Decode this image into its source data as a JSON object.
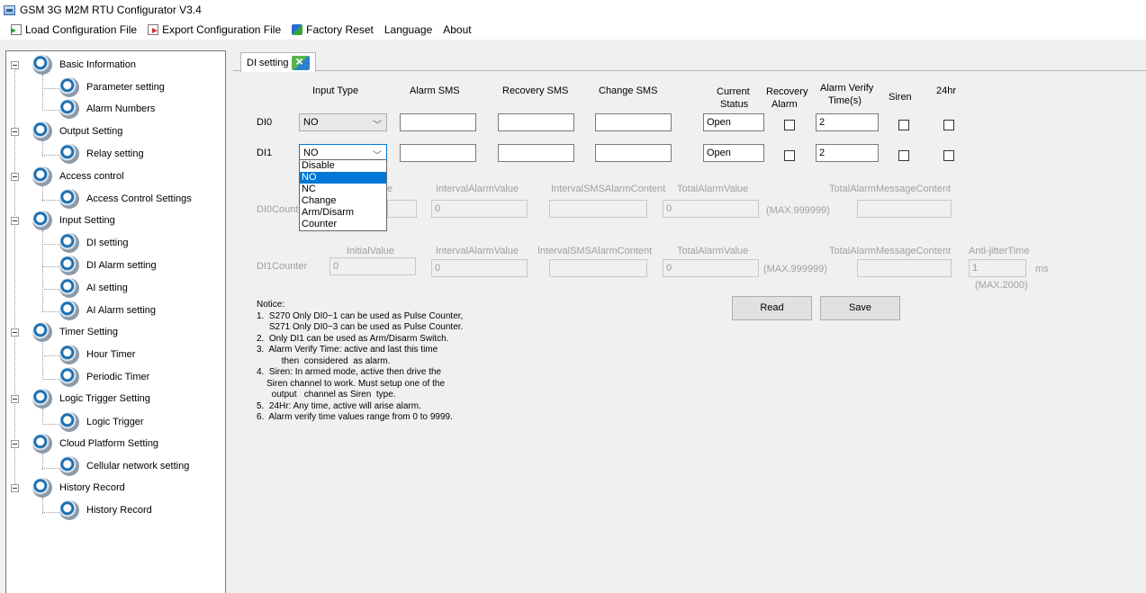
{
  "window": {
    "title": "GSM 3G M2M RTU Configurator V3.4"
  },
  "menu": {
    "load_config": "Load Configuration File",
    "export_config": "Export Configuration File",
    "factory_reset": "Factory Reset",
    "language": "Language",
    "about": "About"
  },
  "tree": {
    "basic_information": "Basic Information",
    "parameter_setting": "Parameter setting",
    "alarm_numbers": "Alarm Numbers",
    "output_setting": "Output Setting",
    "relay_setting": "Relay setting",
    "access_control": "Access control",
    "access_control_settings": "Access Control Settings",
    "input_setting": "Input Setting",
    "di_setting": "DI setting",
    "di_alarm_setting": "DI Alarm setting",
    "ai_setting": "AI setting",
    "ai_alarm_setting": "AI Alarm setting",
    "timer_setting": "Timer Setting",
    "hour_timer": "Hour Timer",
    "periodic_timer": "Periodic Timer",
    "logic_trigger_setting": "Logic Trigger Setting",
    "logic_trigger": "Logic Trigger",
    "cloud_platform_setting": "Cloud Platform Setting",
    "cellular_network_setting": "Cellular network setting",
    "history_record_group": "History Record",
    "history_record": "History Record"
  },
  "tab": {
    "label": "DI setting"
  },
  "headers": {
    "input_type": "Input Type",
    "alarm_sms": "Alarm SMS",
    "recovery_sms": "Recovery SMS",
    "change_sms": "Change SMS",
    "current_status_1": "Current",
    "current_status_2": "Status",
    "recovery_alarm_1": "Recovery",
    "recovery_alarm_2": "Alarm",
    "alarm_verify_1": "Alarm Verify",
    "alarm_verify_2": "Time(s)",
    "siren": "Siren",
    "hr24": "24hr"
  },
  "di0": {
    "label": "DI0",
    "input_type": "NO",
    "alarm_sms": "",
    "recovery_sms": "",
    "change_sms": "",
    "status": "Open",
    "verify_time": "2"
  },
  "di1": {
    "label": "DI1",
    "input_type": "NO",
    "alarm_sms": "",
    "recovery_sms": "",
    "change_sms": "",
    "status": "Open",
    "verify_time": "2"
  },
  "dropdown_options": [
    "Disable",
    "NO",
    "NC",
    "Change",
    "Arm/Disarm",
    "Counter"
  ],
  "dropdown_selected": "NO",
  "counter0": {
    "label": "DI0Counter",
    "initial_value_header_partial": "e",
    "interval_alarm_header": "IntervalAlarmValue",
    "interval_sms_header": "IntervalSMSAlarmContent",
    "total_alarm_header": "TotalAlarmValue",
    "total_msg_header": "TotalAlarmMessageContent",
    "interval_alarm_value": "0",
    "total_alarm_value": "0",
    "max_note": "(MAX.999999)"
  },
  "counter1": {
    "label": "DI1Counter",
    "initial_value_header": "InitialValue",
    "interval_alarm_header": "IntervalAlarmValue",
    "interval_sms_header": "IntervalSMSAlarmContent",
    "total_alarm_header": "TotalAlarmValue",
    "total_msg_header": "TotalAlarmMessageContent",
    "anti_jitter_header": "Anti-jitterTime",
    "initial_value": "0",
    "interval_alarm_value": "0",
    "total_alarm_value": "0",
    "max_note": "(MAX.999999)",
    "anti_jitter_value": "1",
    "anti_jitter_unit": "ms",
    "anti_jitter_max": "(MAX.2000)"
  },
  "buttons": {
    "read": "Read",
    "save": "Save"
  },
  "notice": {
    "title": "Notice:",
    "lines": [
      "1.  S270 Only DI0~1 can be used as Pulse Counter,",
      "     S271 Only DI0~3 can be used as Pulse Counter.",
      "2.  Only DI1 can be used as Arm/Disarm Switch.",
      "3.  Alarm Verify Time: active and last this time",
      "          then  considered  as alarm.",
      "4.  Siren: In armed mode, active then drive the",
      "    Siren channel to work. Must setup one of the",
      "      output   channel as Siren  type.",
      "5.  24Hr: Any time, active will arise alarm.",
      "6.  Alarm verify time values range from 0 to 9999."
    ]
  }
}
